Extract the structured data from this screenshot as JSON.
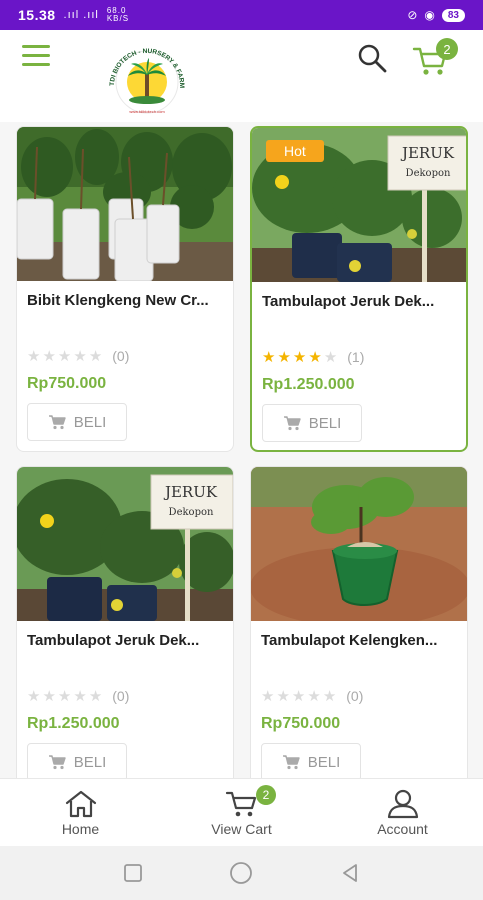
{
  "status_bar": {
    "time": "15.38",
    "signal": ".ııl .ııl",
    "net_speed": "68.0 KB/S",
    "battery": "83"
  },
  "header": {
    "logo_text": "TDI BIOTECH - NURSERY & FARM",
    "cart_count": "2"
  },
  "products": [
    {
      "name": "Bibit Klengkeng New Cr...",
      "rating": 0,
      "review_count": "(0)",
      "price": "Rp750.000",
      "buy_label": "BELI",
      "badge": ""
    },
    {
      "name": "Tambulapot Jeruk Dek...",
      "rating": 4,
      "review_count": "(1)",
      "price": "Rp1.250.000",
      "buy_label": "BELI",
      "badge": "Hot",
      "sign": {
        "line1": "JERUK",
        "line2": "Dekopon"
      }
    },
    {
      "name": "Tambulapot Jeruk Dek...",
      "rating": 0,
      "review_count": "(0)",
      "price": "Rp1.250.000",
      "buy_label": "BELI",
      "badge": "",
      "sign": {
        "line1": "JERUK",
        "line2": "Dekopon"
      }
    },
    {
      "name": "Tambulapot Kelengken...",
      "rating": 0,
      "review_count": "(0)",
      "price": "Rp750.000",
      "buy_label": "BELI",
      "badge": ""
    }
  ],
  "bottom_nav": {
    "home": "Home",
    "cart": "View Cart",
    "cart_count": "2",
    "account": "Account"
  },
  "colors": {
    "accent": "#7ab340",
    "status_bar": "#6a15c8",
    "hot_badge": "#f6a51c",
    "star": "#f4b400"
  }
}
